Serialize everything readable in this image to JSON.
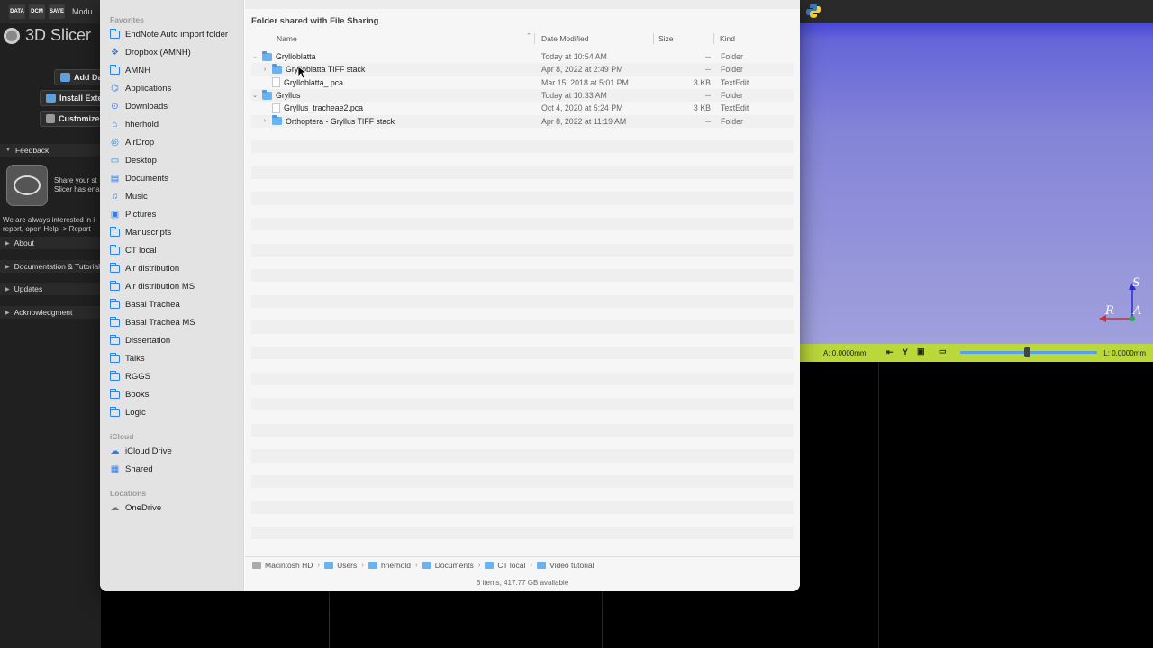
{
  "slicer": {
    "toolbar": {
      "data_label": "DATA",
      "dcm_label": "DCM",
      "save_label": "SAVE",
      "modules_label": "Modu"
    },
    "app_title": "3D Slicer",
    "buttons": {
      "add_data": "Add Da",
      "install_extensions": "Install Exte",
      "customize": "Customize S"
    },
    "sections": {
      "feedback": "Feedback",
      "about": "About",
      "documentation": "Documentation & Tutorials",
      "updates": "Updates",
      "acknowledgment": "Acknowledgment"
    },
    "feedback_text": [
      "Share your st",
      "Slicer has ena"
    ],
    "feedback_note": [
      "We are always interested in i",
      "report, open Help -> Report"
    ],
    "axes": {
      "s": "S",
      "r": "R",
      "a": "A"
    },
    "slice": {
      "left_value": "A: 0.0000mm",
      "right_value": "L: 0.0000mm",
      "y_label": "Y"
    }
  },
  "dialog": {
    "sidebar": {
      "favorites_label": "Favorites",
      "favorites": [
        {
          "label": "EndNote Auto import folder",
          "icon": "folder-icon"
        },
        {
          "label": "Dropbox (AMNH)",
          "icon": "dropbox-icon"
        },
        {
          "label": "AMNH",
          "icon": "folder-icon"
        },
        {
          "label": "Applications",
          "icon": "applications-icon"
        },
        {
          "label": "Downloads",
          "icon": "downloads-icon"
        },
        {
          "label": "hherhold",
          "icon": "home-icon"
        },
        {
          "label": "AirDrop",
          "icon": "airdrop-icon"
        },
        {
          "label": "Desktop",
          "icon": "desktop-icon"
        },
        {
          "label": "Documents",
          "icon": "documents-icon"
        },
        {
          "label": "Music",
          "icon": "music-icon"
        },
        {
          "label": "Pictures",
          "icon": "pictures-icon"
        },
        {
          "label": "Manuscripts",
          "icon": "folder-icon"
        },
        {
          "label": "CT local",
          "icon": "folder-icon"
        },
        {
          "label": "Air distribution",
          "icon": "folder-icon"
        },
        {
          "label": "Air distribution MS",
          "icon": "folder-icon"
        },
        {
          "label": "Basal Trachea",
          "icon": "folder-icon"
        },
        {
          "label": "Basal Trachea MS",
          "icon": "folder-icon"
        },
        {
          "label": "Dissertation",
          "icon": "folder-icon"
        },
        {
          "label": "Talks",
          "icon": "folder-icon"
        },
        {
          "label": "RGGS",
          "icon": "folder-icon"
        },
        {
          "label": "Books",
          "icon": "folder-icon"
        },
        {
          "label": "Logic",
          "icon": "folder-icon"
        }
      ],
      "icloud_label": "iCloud",
      "icloud": [
        {
          "label": "iCloud Drive",
          "icon": "icloud-icon"
        },
        {
          "label": "Shared",
          "icon": "shared-icon"
        }
      ],
      "locations_label": "Locations",
      "locations": [
        {
          "label": "OneDrive",
          "icon": "cloud-icon"
        }
      ]
    },
    "location_title": "Folder shared with File Sharing",
    "columns": {
      "name": "Name",
      "date": "Date Modified",
      "size": "Size",
      "kind": "Kind"
    },
    "rows": [
      {
        "name": "Grylloblatta",
        "date": "Today at 10:54 AM",
        "size": "--",
        "kind": "Folder",
        "type": "folder",
        "level": 0,
        "expanded": true
      },
      {
        "name": "Grylloblatta TIFF stack",
        "date": "Apr 8, 2022 at 2:49 PM",
        "size": "--",
        "kind": "Folder",
        "type": "folder",
        "level": 1,
        "expanded": false
      },
      {
        "name": "Grylloblatta_.pca",
        "date": "Mar 15, 2018 at 5:01 PM",
        "size": "3 KB",
        "kind": "TextEdit",
        "type": "file",
        "level": 1
      },
      {
        "name": "Gryllus",
        "date": "Today at 10:33 AM",
        "size": "--",
        "kind": "Folder",
        "type": "folder",
        "level": 0,
        "expanded": true
      },
      {
        "name": "Gryllus_tracheae2.pca",
        "date": "Oct 4, 2020 at 5:24 PM",
        "size": "3 KB",
        "kind": "TextEdit",
        "type": "file",
        "level": 1
      },
      {
        "name": "Orthoptera - Gryllus TIFF stack",
        "date": "Apr 8, 2022 at 11:19 AM",
        "size": "--",
        "kind": "Folder",
        "type": "folder",
        "level": 1,
        "expanded": false
      }
    ],
    "path": [
      "Macintosh HD",
      "Users",
      "hherhold",
      "Documents",
      "CT local",
      "Video tutorial"
    ],
    "status": "6 items, 417.77 GB available"
  },
  "colors": {
    "accent": "#2d7ee6",
    "folder": "#6bb3f0",
    "slice_bar": "#bbd83a",
    "view_top": "#4848d8"
  }
}
